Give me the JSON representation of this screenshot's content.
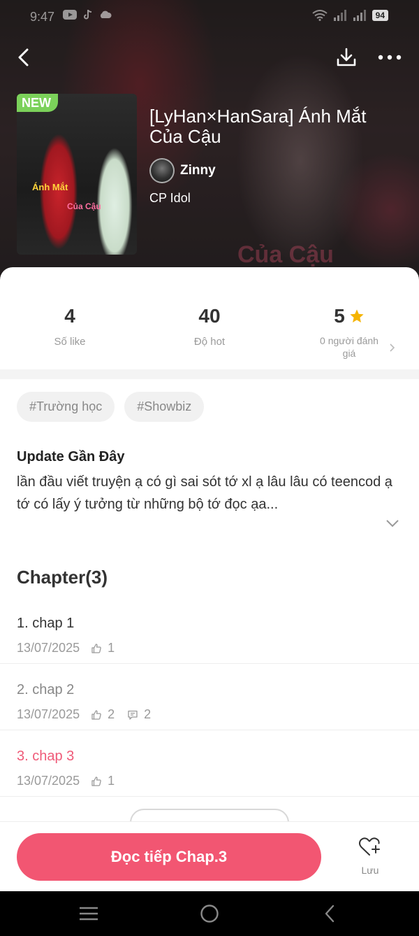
{
  "status_bar": {
    "time": "9:47",
    "battery": "94"
  },
  "cover": {
    "badge": "NEW",
    "text_1": "Ánh Mắt",
    "text_2": "Của Cậu"
  },
  "story": {
    "title": "[LyHan×HanSara] Ánh Mắt Của Cậu",
    "author": "Zinny",
    "category": "CP Idol"
  },
  "stats": [
    {
      "value": "4",
      "label": "Số like"
    },
    {
      "value": "40",
      "label": "Độ hot"
    },
    {
      "value": "5",
      "label": "0 người đánh giá"
    }
  ],
  "tags": [
    "#Trường học",
    "#Showbiz"
  ],
  "update": {
    "title": "Update Gần Đây",
    "lines": [
      "lần đầu viết truyện ạ có gì sai sót tớ xl ạ lâu lâu có teencod ạ",
      "tớ có lấy ý tưởng từ những bộ tớ đọc ạa..."
    ]
  },
  "chapters_heading": "Chapter(3)",
  "chapters": [
    {
      "title": "1. chap 1",
      "date": "13/07/2025",
      "likes": "1",
      "comments": null,
      "state": "normal"
    },
    {
      "title": "2. chap 2",
      "date": "13/07/2025",
      "likes": "2",
      "comments": "2",
      "state": "read"
    },
    {
      "title": "3. chap 3",
      "date": "13/07/2025",
      "likes": "1",
      "comments": null,
      "state": "current"
    }
  ],
  "action_bar": {
    "read_label": "Đọc tiếp Chap.3",
    "save_label": "Lưu"
  },
  "colors": {
    "accent": "#f25672",
    "current_chapter": "#ef5a78",
    "new_badge": "#7bd15a",
    "star": "#f5b400"
  }
}
